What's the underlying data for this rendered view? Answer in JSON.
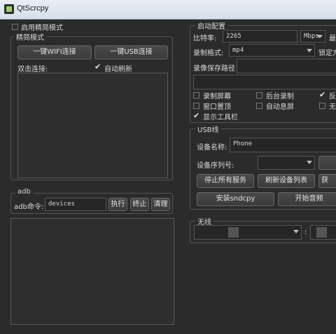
{
  "window": {
    "title": "QtScrcpy"
  },
  "left": {
    "simple_mode_checkbox": "启用精简模式",
    "simple_group": {
      "title": "精简模式",
      "wifi_btn": "一键WIFI连接",
      "usb_btn": "一键USB连接",
      "dblclick_label": "双击连接:",
      "auto_refresh": "自动刷新"
    },
    "adb_group": {
      "title": "adb",
      "cmd_label": "adb命令:",
      "cmd_value": "devices",
      "exec_btn": "执行",
      "stop_btn": "终止",
      "clear_btn": "清理"
    }
  },
  "right": {
    "config": {
      "title": "启动配置",
      "bitrate_label": "比特率:",
      "bitrate_value": "2265",
      "bitrate_unit": "Mbps",
      "max_label": "最",
      "record_format_label": "录制格式:",
      "record_format_value": "mp4",
      "lock_label": "锁定方",
      "record_path_label": "录像保存路径",
      "options": [
        {
          "label": "录制屏幕",
          "checked": false
        },
        {
          "label": "后台录制",
          "checked": false
        },
        {
          "label": "反",
          "checked": true
        },
        {
          "label": "窗口置顶",
          "checked": false
        },
        {
          "label": "自动息屏",
          "checked": false
        },
        {
          "label": "无",
          "checked": false
        },
        {
          "label": "显示工具栏",
          "checked": true
        }
      ]
    },
    "usb": {
      "title": "USB线",
      "device_name_label": "设备名称:",
      "device_name_value": "Phone",
      "serial_label": "设备序列号:",
      "stop_all_btn": "停止所有服务",
      "refresh_btn": "刷新设备列表",
      "extra_btn": "获",
      "install_btn": "安装sndcpy",
      "audio_btn": "开始音频"
    },
    "wireless": {
      "title": "无线",
      "colon": ":"
    }
  }
}
